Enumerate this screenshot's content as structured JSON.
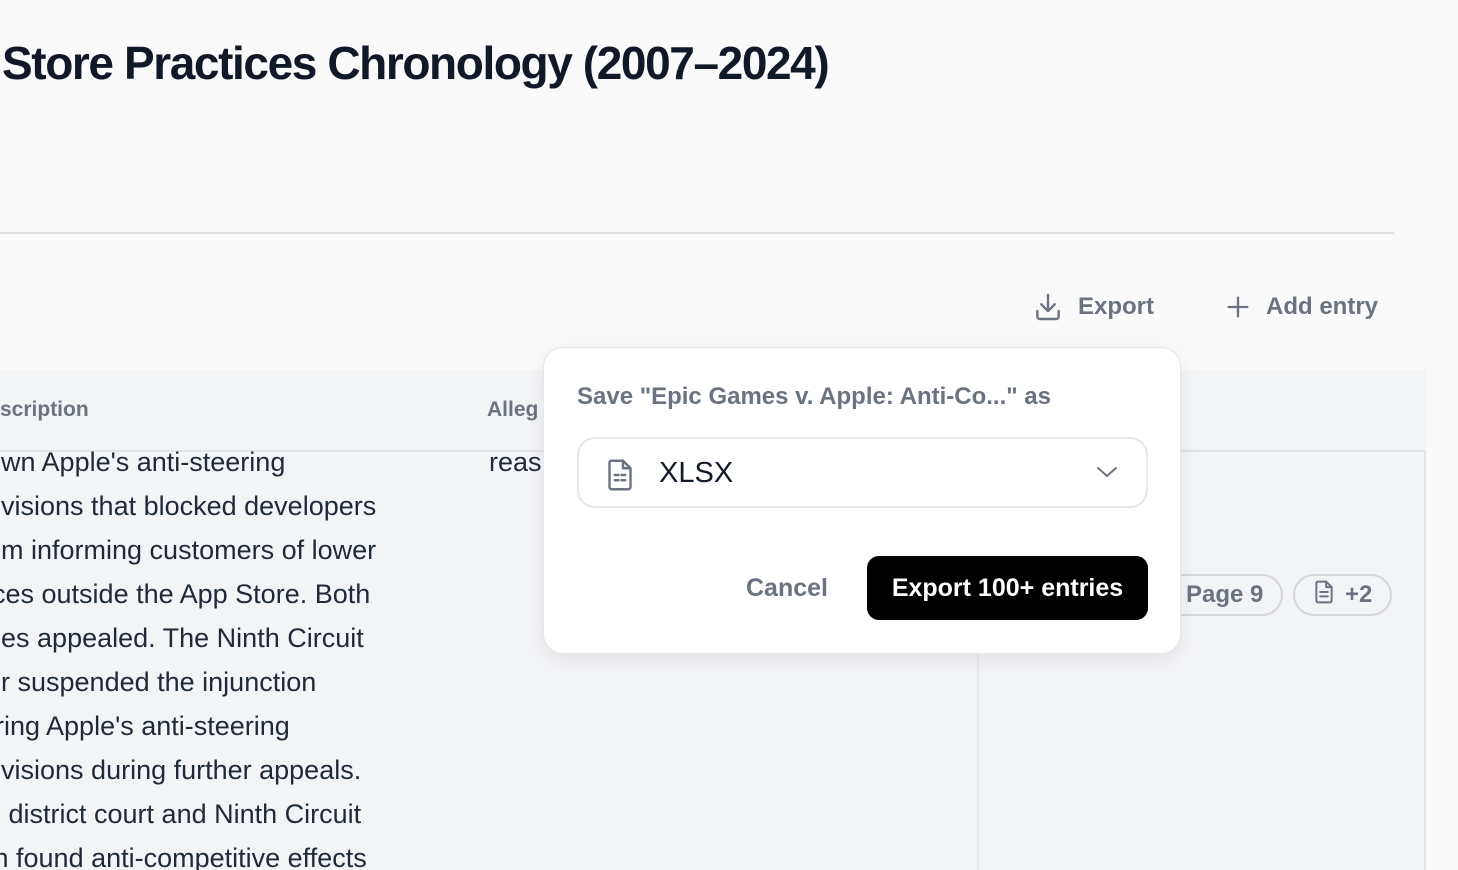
{
  "page": {
    "title": "Store Practices Chronology (2007–2024)"
  },
  "toolbar": {
    "export_label": "Export",
    "add_entry_label": "Add entry"
  },
  "table": {
    "headers": {
      "description": "scription",
      "allegation": "Alleg"
    },
    "row": {
      "description_lines": [
        "own Apple's anti-steering",
        "ovisions that blocked developers",
        "om informing customers of lower",
        "ices outside the App Store. Both",
        "des appealed. The Ninth Circuit",
        "er suspended the injunction",
        "rring Apple's anti-steering",
        "ovisions during further appeals.",
        "e district court and Ninth Circuit",
        "th found anti-competitive effects"
      ],
      "allegation_text": "reas",
      "source_chip": "Page 9",
      "more_docs_chip": "+2"
    }
  },
  "export_dialog": {
    "label": "Save \"Epic Games v. Apple: Anti-Co...\" as",
    "format_value": "XLSX",
    "cancel_label": "Cancel",
    "confirm_label": "Export 100+ entries"
  },
  "icons": {
    "export": "download-icon",
    "add": "plus-icon",
    "format": "file-spreadsheet-icon",
    "dropdown": "chevron-down-icon",
    "doc_chip": "document-icon"
  }
}
